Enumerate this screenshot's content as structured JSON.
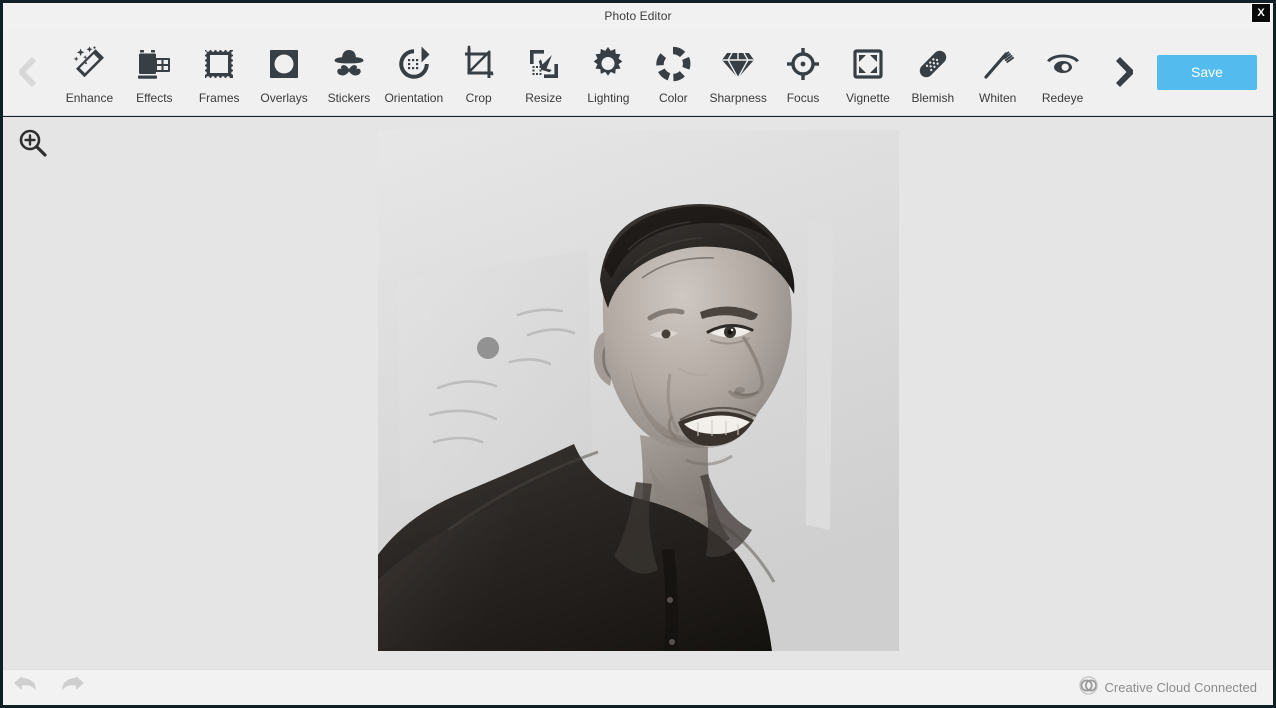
{
  "window": {
    "title": "Photo Editor",
    "close_label": "X"
  },
  "toolbar": {
    "prev_icon": "chevron-left-icon",
    "next_icon": "chevron-right-icon",
    "save_label": "Save",
    "save_color": "#53bbee",
    "tools": [
      {
        "label": "Enhance",
        "icon": "magic-wand-icon"
      },
      {
        "label": "Effects",
        "icon": "film-roll-icon"
      },
      {
        "label": "Frames",
        "icon": "picture-frame-icon"
      },
      {
        "label": "Overlays",
        "icon": "circle-in-square-icon"
      },
      {
        "label": "Stickers",
        "icon": "hat-mustache-icon"
      },
      {
        "label": "Orientation",
        "icon": "rotate-icon"
      },
      {
        "label": "Crop",
        "icon": "crop-icon"
      },
      {
        "label": "Resize",
        "icon": "resize-arrow-icon"
      },
      {
        "label": "Lighting",
        "icon": "sun-icon"
      },
      {
        "label": "Color",
        "icon": "color-wheel-icon"
      },
      {
        "label": "Sharpness",
        "icon": "diamond-icon"
      },
      {
        "label": "Focus",
        "icon": "focus-target-icon"
      },
      {
        "label": "Vignette",
        "icon": "vignette-corners-icon"
      },
      {
        "label": "Blemish",
        "icon": "bandage-icon"
      },
      {
        "label": "Whiten",
        "icon": "toothbrush-icon"
      },
      {
        "label": "Redeye",
        "icon": "eye-icon"
      }
    ]
  },
  "canvas": {
    "zoom_icon": "zoom-in-magnifier-icon",
    "photo_alt": "Black and white portrait of a smiling man in a dark shirt",
    "background_color": "#e5e5e5"
  },
  "bottombar": {
    "undo_icon": "undo-arrow-icon",
    "redo_icon": "redo-arrow-icon",
    "status_icon": "creative-cloud-icon",
    "status_label": "Creative Cloud Connected"
  }
}
